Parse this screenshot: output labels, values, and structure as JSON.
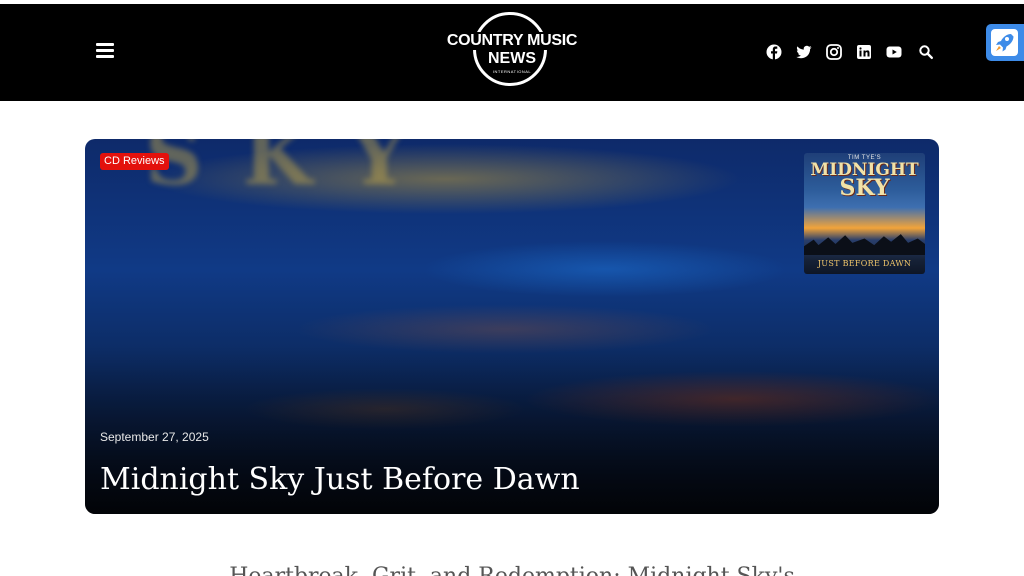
{
  "header": {
    "logo": {
      "line1": "COUNTRY MUSIC",
      "line2": "NEWS",
      "line3": "INTERNATIONAL"
    },
    "social_icons": [
      "facebook-icon",
      "twitter-icon",
      "instagram-icon",
      "linkedin-icon",
      "youtube-icon",
      "search-icon"
    ]
  },
  "hero": {
    "category": "CD Reviews",
    "date": "September 27, 2025",
    "title": "Midnight Sky Just Before Dawn",
    "cover": {
      "artist": "TIM TYE'S",
      "title_line1": "MIDNIGHT",
      "title_line2": "SKY",
      "subtitle": "JUST BEFORE DAWN"
    }
  },
  "article": {
    "heading_partial": "Heartbreak, Grit, and Redemption: Midnight Sky's"
  },
  "colors": {
    "header_bg": "#000000",
    "badge": "#e3110c",
    "rocket": "#3d8be8"
  }
}
